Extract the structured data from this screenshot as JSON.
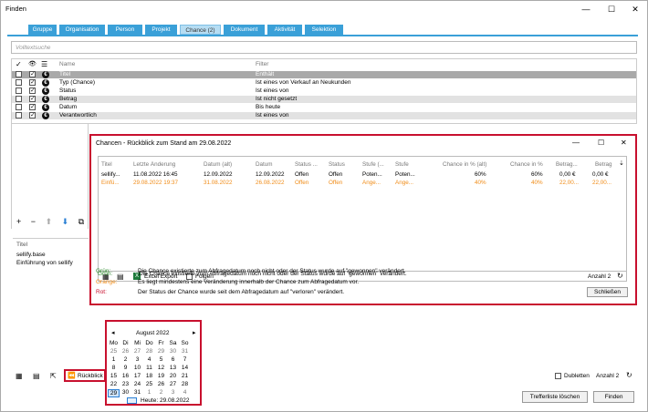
{
  "window": {
    "title": "Finden",
    "min": "—",
    "max": "☐",
    "close": "✕"
  },
  "tabs": [
    "Gruppe",
    "Organisation",
    "Person",
    "Projekt",
    "Chance (2)",
    "Dokument",
    "Aktivität",
    "Selektion"
  ],
  "search": {
    "placeholder": "Volltextsuche"
  },
  "filter": {
    "col_name": "Name",
    "col_filter": "Filter",
    "rows": [
      {
        "name": "Titel",
        "filter": "Enthält"
      },
      {
        "name": "Typ (Chance)",
        "filter": "Ist eines von Verkauf an Neukunden"
      },
      {
        "name": "Status",
        "filter": "Ist eines von"
      },
      {
        "name": "Betrag",
        "filter": "Ist nicht gesetzt"
      },
      {
        "name": "Datum",
        "filter": "Bis heute"
      },
      {
        "name": "Verantwortlich",
        "filter": "Ist eines von"
      }
    ]
  },
  "toolbar": {
    "add": "+",
    "remove": "−",
    "up": "⬆",
    "down": "⬇",
    "copy": "⧉"
  },
  "results": {
    "header": "Titel",
    "items": [
      "sellify.base",
      "Einführung von sellify"
    ]
  },
  "popup": {
    "title": "Chancen - Rückblick zum Stand am 29.08.2022",
    "min": "—",
    "max": "☐",
    "close": "✕",
    "columns": [
      "Titel",
      "Letzte Änderung",
      "Datum (alt)",
      "Datum",
      "Status ...",
      "Status",
      "Stufe (...",
      "Stufe",
      "Chance in % (alt)",
      "Chance in %",
      "Betrag...",
      "Betrag"
    ],
    "rows": [
      [
        "sellify...",
        "11.08.2022 16:45",
        "12.09.2022",
        "12.09.2022",
        "Offen",
        "Offen",
        "Poten...",
        "Poten...",
        "60%",
        "60%",
        "0,00 €",
        "0,00 €"
      ],
      [
        "Einfü...",
        "29.08.2022 19:37",
        "31.08.2022",
        "26.08.2022",
        "Offen",
        "Offen",
        "Ange...",
        "Ange...",
        "40%",
        "40%",
        "22,00...",
        "22,00..."
      ]
    ],
    "excel": "Excel Export",
    "follow": "Folgen",
    "count": "Anzahl 2",
    "legend": [
      {
        "k": "Grün:",
        "v": "Die Chance existierte zum Abfragedatum noch nicht oder der Status wurde auf \"gewonnen\" verändert.",
        "c": "#2e8b2e"
      },
      {
        "k": "Orange:",
        "v": "Es liegt mindestens eine Veränderung innerhalb der Chance zum Abfragedatum vor.",
        "c": "#f08c18"
      },
      {
        "k": "Rot:",
        "v": "Der Status der Chance wurde seit dem Abfragedatum auf \"verloren\" verändert.",
        "c": "#c8102e"
      }
    ],
    "close_btn": "Schließen"
  },
  "calendar": {
    "month": "August 2022",
    "prev": "◂",
    "next": "▸",
    "days": [
      "Mo",
      "Di",
      "Mi",
      "Do",
      "Fr",
      "Sa",
      "So"
    ],
    "weeks": [
      [
        "25",
        "26",
        "27",
        "28",
        "29",
        "30",
        "31"
      ],
      [
        "1",
        "2",
        "3",
        "4",
        "5",
        "6",
        "7"
      ],
      [
        "8",
        "9",
        "10",
        "11",
        "12",
        "13",
        "14"
      ],
      [
        "15",
        "16",
        "17",
        "18",
        "19",
        "20",
        "21"
      ],
      [
        "22",
        "23",
        "24",
        "25",
        "26",
        "27",
        "28"
      ],
      [
        "29",
        "30",
        "31",
        "1",
        "2",
        "3",
        "4"
      ]
    ],
    "today": "Heute: 29.08.2022"
  },
  "bottom": {
    "rueckblick": "Rückblick",
    "dubletten": "Dubletten",
    "count": "Anzahl 2",
    "clear": "Trefferliste löschen",
    "find": "Finden"
  },
  "colors": {
    "accent": "#3aa0d8",
    "highlight": "#c8102e",
    "orange": "#f08c18"
  }
}
